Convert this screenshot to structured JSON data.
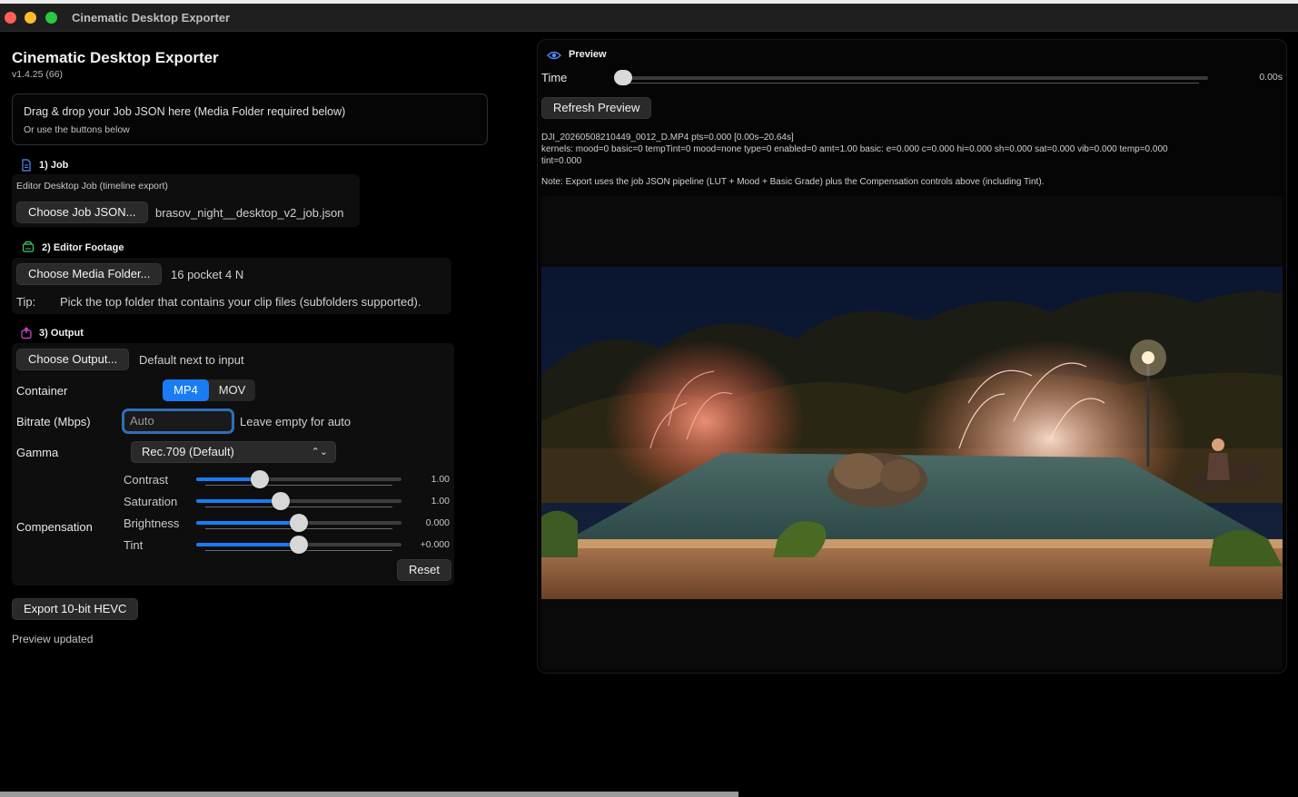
{
  "window": {
    "title": "Cinematic Desktop Exporter"
  },
  "app": {
    "title": "Cinematic Desktop Exporter",
    "version": "v1.4.25 (66)"
  },
  "dropzone": {
    "main": "Drag & drop your Job JSON here (Media Folder required below)",
    "sub": "Or use the buttons below"
  },
  "job": {
    "section_label": "1) Job",
    "description": "Editor Desktop Job (timeline export)",
    "choose_button": "Choose Job JSON...",
    "filename": "brasov_night__desktop_v2_job.json"
  },
  "footage": {
    "section_label": "2) Editor Footage",
    "choose_button": "Choose Media Folder...",
    "folder": "16 pocket 4 N",
    "tip_label": "Tip:",
    "tip_text": "Pick the top folder that contains your clip files (subfolders supported)."
  },
  "output": {
    "section_label": "3) Output",
    "choose_button": "Choose Output...",
    "destination": "Default next to input",
    "container_label": "Container",
    "container_options": [
      "MP4",
      "MOV"
    ],
    "container_selected": "MP4",
    "bitrate_label": "Bitrate (Mbps)",
    "bitrate_placeholder": "Auto",
    "bitrate_hint": "Leave empty for auto",
    "gamma_label": "Gamma",
    "gamma_value": "Rec.709 (Default)",
    "compensation_label": "Compensation",
    "sliders": [
      {
        "label": "Contrast",
        "value": "1.00",
        "fraction": 0.31
      },
      {
        "label": "Saturation",
        "value": "1.00",
        "fraction": 0.41
      },
      {
        "label": "Brightness",
        "value": "0.000",
        "fraction": 0.5
      },
      {
        "label": "Tint",
        "value": "+0.000",
        "fraction": 0.5
      }
    ],
    "reset_button": "Reset"
  },
  "export_button": "Export 10-bit HEVC",
  "status": "Preview updated",
  "preview": {
    "title": "Preview",
    "time_label": "Time",
    "time_value": "0.00s",
    "time_fraction": 0.0,
    "refresh_button": "Refresh Preview",
    "info_line1": "DJI_20260508210449_0012_D.MP4  pts=0.000  [0.00s–20.64s]",
    "info_line2": "kernels: mood=0 basic=0 tempTint=0  mood=none type=0 enabled=0 amt=1.00  basic: e=0.000 c=0.000 hi=0.000 sh=0.000 sat=0.000 vib=0.000 temp=0.000",
    "info_line3": "tint=0.000",
    "note": "Note: Export uses the job JSON pipeline (LUT + Mood + Basic Grade) plus the Compensation controls above (including Tint)."
  },
  "colors": {
    "accent": "#1a7cf5",
    "background": "#000000",
    "panel": "#0e0e0e"
  }
}
